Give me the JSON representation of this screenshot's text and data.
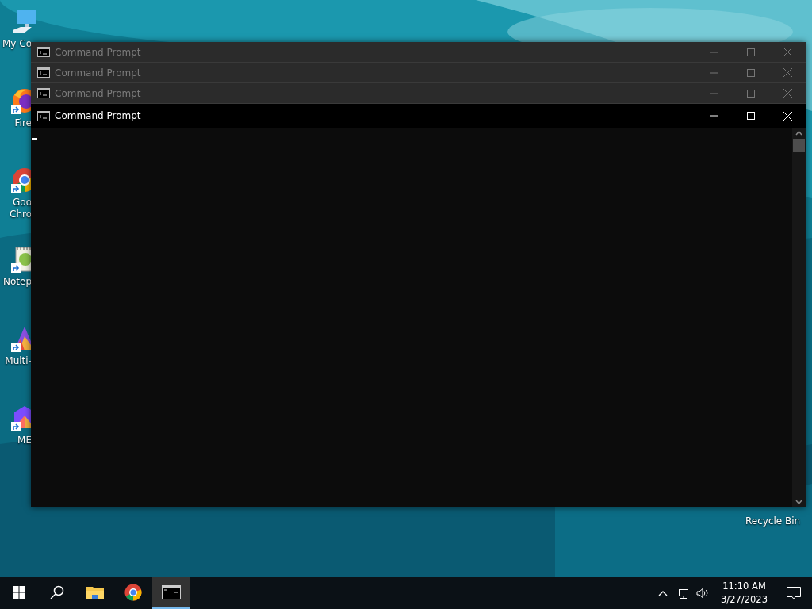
{
  "desktop_icons": [
    {
      "kind": "computer",
      "lines": [
        "My Co"
      ]
    },
    {
      "kind": "firefox",
      "lines": [
        "Fire"
      ]
    },
    {
      "kind": "chrome",
      "lines": [
        "Goo",
        "Chro"
      ]
    },
    {
      "kind": "notepad",
      "lines": [
        "Notep"
      ]
    },
    {
      "kind": "multi",
      "lines": [
        "Multi-"
      ]
    },
    {
      "kind": "me",
      "lines": [
        "ME"
      ]
    }
  ],
  "recycle_bin": {
    "label": "Recycle Bin"
  },
  "windows": [
    {
      "title": "Command Prompt",
      "active": false
    },
    {
      "title": "Command Prompt",
      "active": false
    },
    {
      "title": "Command Prompt",
      "active": false
    },
    {
      "title": "Command Prompt",
      "active": true
    }
  ],
  "taskbar": {
    "items": [
      {
        "kind": "start",
        "selected": false
      },
      {
        "kind": "search",
        "selected": false
      },
      {
        "kind": "explorer",
        "selected": false
      },
      {
        "kind": "chrome",
        "selected": false
      },
      {
        "kind": "cmd",
        "selected": true
      }
    ],
    "time": "11:10 AM",
    "date": "3/27/2023"
  }
}
